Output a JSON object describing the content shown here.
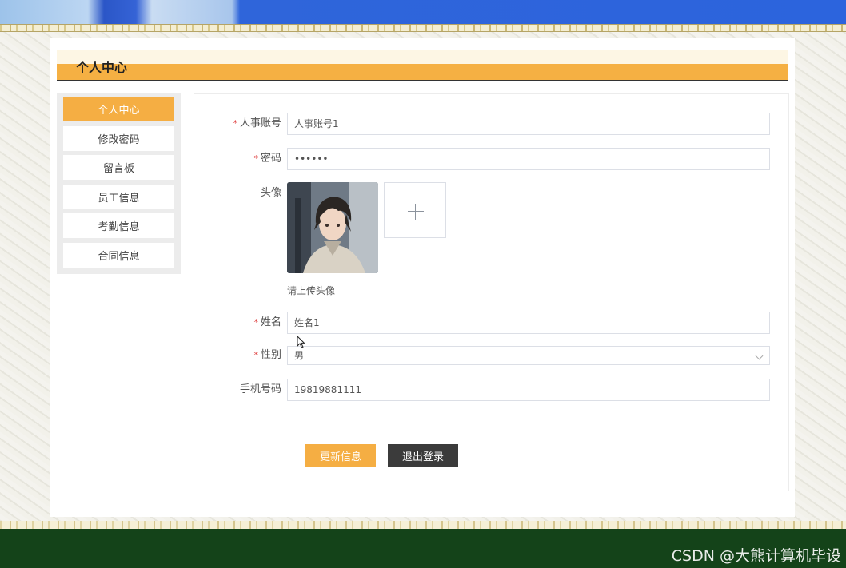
{
  "page": {
    "title": "个人中心"
  },
  "sidebar": {
    "items": [
      {
        "label": "个人中心",
        "active": true
      },
      {
        "label": "修改密码"
      },
      {
        "label": "留言板"
      },
      {
        "label": "员工信息"
      },
      {
        "label": "考勤信息"
      },
      {
        "label": "合同信息"
      }
    ]
  },
  "form": {
    "account": {
      "label": "人事账号",
      "value": "人事账号1",
      "required": true
    },
    "password": {
      "label": "密码",
      "value": "••••••",
      "required": true
    },
    "avatar": {
      "label": "头像",
      "hint": "请上传头像",
      "upload_icon": "plus-icon"
    },
    "name": {
      "label": "姓名",
      "value": "姓名1",
      "required": true
    },
    "gender": {
      "label": "性别",
      "value": "男",
      "required": true
    },
    "phone": {
      "label": "手机号码",
      "value": "19819881111"
    },
    "required_mark": "*"
  },
  "buttons": {
    "update": "更新信息",
    "logout": "退出登录"
  },
  "watermark": "CSDN @大熊计算机毕设",
  "colors": {
    "accent": "#f5ae43",
    "footer": "#144319",
    "dark_button": "#3b3b3b"
  }
}
